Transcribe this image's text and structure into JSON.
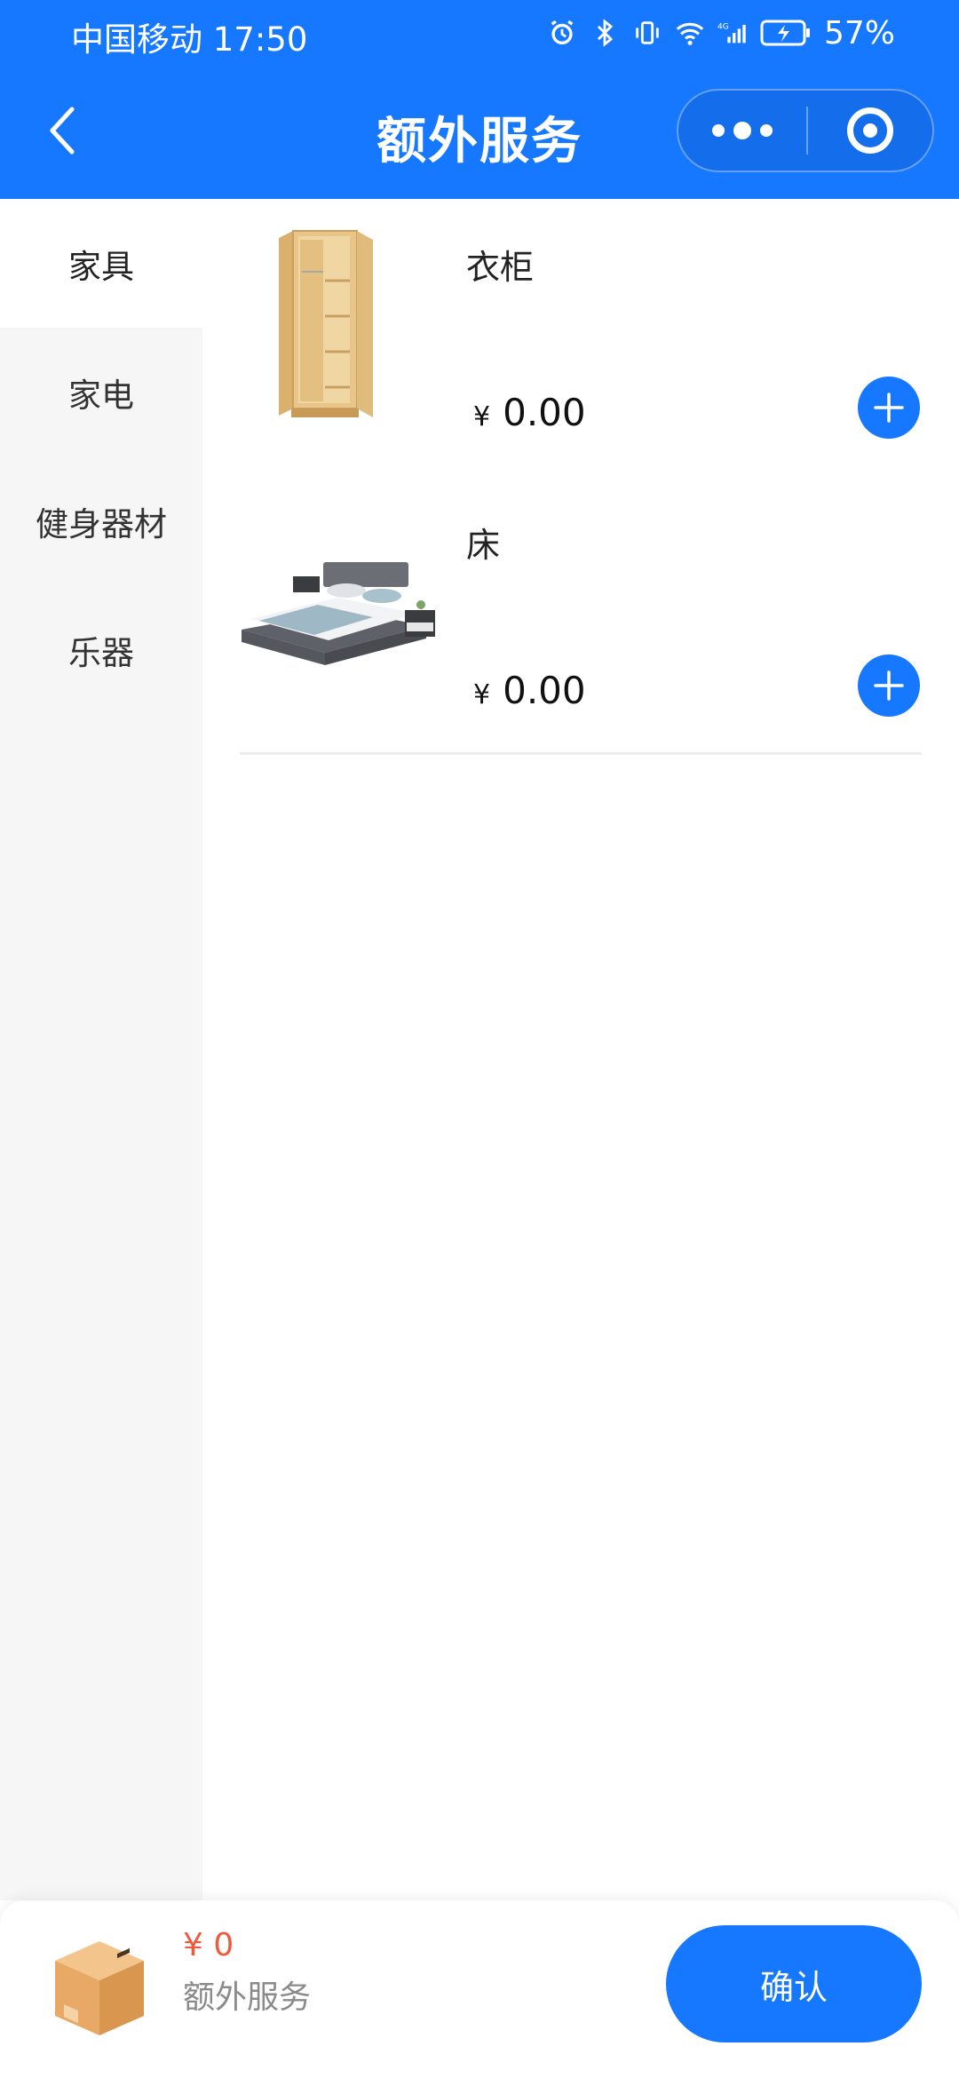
{
  "status_bar": {
    "carrier_time": "中国移动 17:50",
    "battery": "57%",
    "network": "4G"
  },
  "navbar": {
    "title": "额外服务",
    "back_icon": "chevron-left-icon",
    "more_icon": "more-dots-icon",
    "close_icon": "target-circle-icon"
  },
  "sidebar": {
    "categories": [
      {
        "label": "家具",
        "active": true
      },
      {
        "label": "家电",
        "active": false
      },
      {
        "label": "健身器材",
        "active": false
      },
      {
        "label": "乐器",
        "active": false
      }
    ]
  },
  "products": [
    {
      "name": "衣柜",
      "currency": "¥",
      "price": "0.00",
      "image": "wardrobe-image"
    },
    {
      "name": "床",
      "currency": "¥",
      "price": "0.00",
      "image": "bed-image"
    }
  ],
  "footer": {
    "total": "¥ 0",
    "label": "额外服务",
    "confirm_label": "确认",
    "box_icon": "package-box-icon"
  },
  "colors": {
    "primary": "#1677ff",
    "price_accent": "#ef5a3c",
    "sidebar_bg": "#f6f6f6"
  }
}
